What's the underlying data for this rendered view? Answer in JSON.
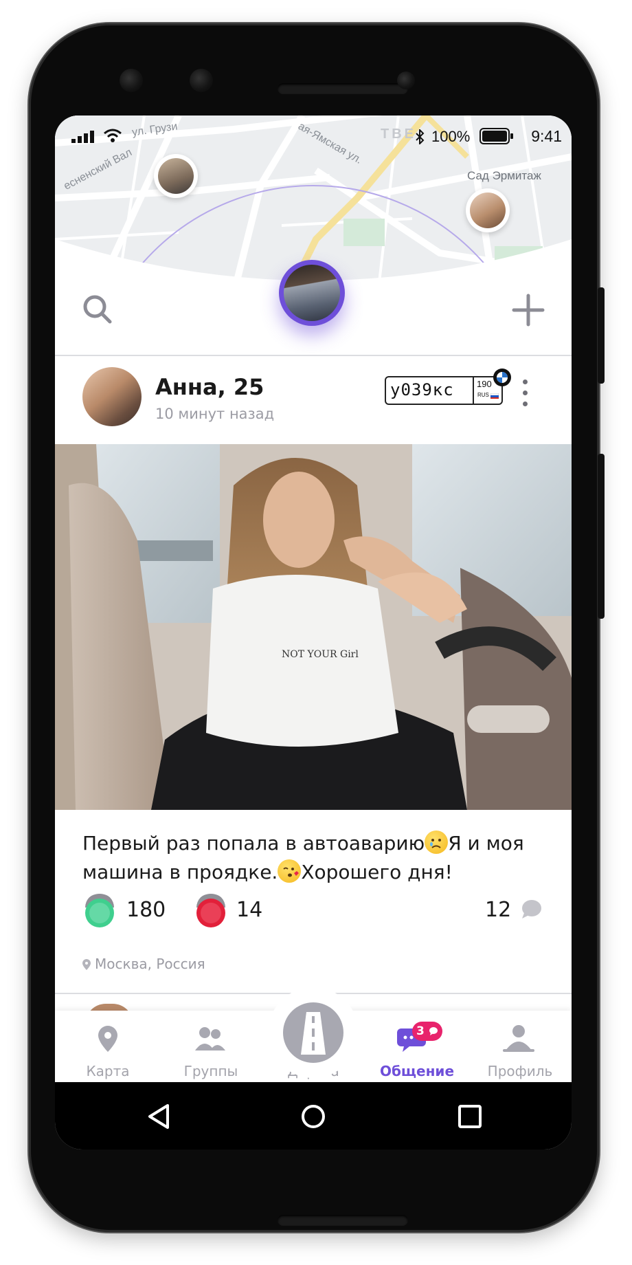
{
  "status_bar": {
    "battery_percent": "100%",
    "time": "9:41"
  },
  "map": {
    "labels": [
      "ул. Грузи",
      "есненский Вал",
      "ая-Ямская ул.",
      "ТВЕ",
      "Сад Эрмитаж"
    ]
  },
  "top_actions": {
    "search_icon": "search-icon",
    "add_icon": "plus-icon"
  },
  "post": {
    "author_name": "Анна, 25",
    "time_ago": "10 минут назад",
    "license_plate": {
      "number": "у039кс",
      "region": "190",
      "country": "RUS"
    },
    "car_brand_icon": "bmw-logo-icon",
    "caption_line_1_a": "Первый раз попала в автоаварию",
    "caption_line_1_b": "Я и моя",
    "caption_line_2_a": "машина в проядке.",
    "caption_line_2_b": "Хорошего дня!",
    "reactions": {
      "green_count": "180",
      "red_count": "14",
      "comments_count": "12"
    },
    "location": "Москва, Россия"
  },
  "tabbar": {
    "items": [
      {
        "label": "Карта",
        "icon": "map-pin-icon",
        "active": false
      },
      {
        "label": "Группы",
        "icon": "group-icon",
        "active": false
      },
      {
        "label": "Дорога",
        "icon": "road-icon",
        "active": false
      },
      {
        "label": "Общение",
        "icon": "chat-icon",
        "active": true,
        "badge": "3"
      },
      {
        "label": "Профиль",
        "icon": "profile-icon",
        "active": false
      }
    ]
  },
  "colors": {
    "accent": "#6e4fd9",
    "badge": "#e8236c",
    "green_light": "#3fcf8e",
    "red_light": "#e2203a"
  }
}
